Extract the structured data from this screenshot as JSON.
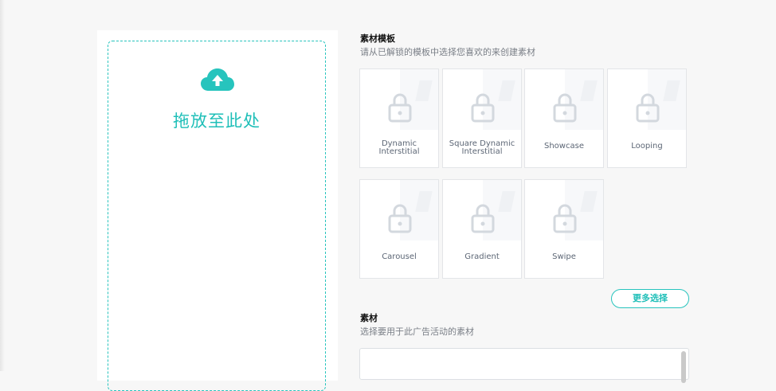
{
  "upload": {
    "drop_label": "拖放至此处",
    "icon": "cloud-upload-icon",
    "accent": "#27c4bd"
  },
  "templates_section": {
    "title": "素材模板",
    "subtitle": "请从已解锁的模板中选择您喜欢的来创建素材"
  },
  "templates": [
    {
      "line1": "Dynamic",
      "line2": "Interstitial",
      "icon": "lock-icon"
    },
    {
      "line1": "Square Dynamic",
      "line2": "Interstitial",
      "icon": "lock-icon"
    },
    {
      "line1": "Showcase",
      "line2": "",
      "icon": "lock-icon"
    },
    {
      "line1": "Looping",
      "line2": "",
      "icon": "lock-icon"
    },
    {
      "line1": "Carousel",
      "line2": "",
      "icon": "lock-icon"
    },
    {
      "line1": "Gradient",
      "line2": "",
      "icon": "lock-icon"
    },
    {
      "line1": "Swipe",
      "line2": "",
      "icon": "lock-icon"
    }
  ],
  "more_button": "更多选择",
  "assets_section": {
    "title": "素材",
    "subtitle": "选择要用于此广告活动的素材"
  }
}
